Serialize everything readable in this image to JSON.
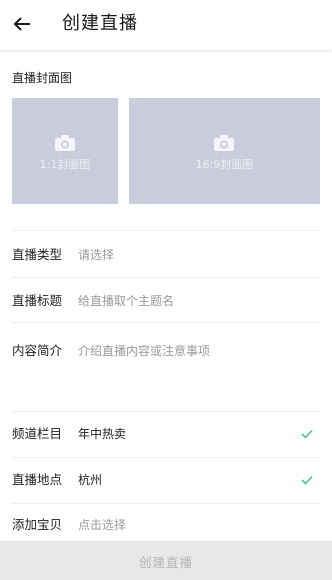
{
  "header": {
    "title": "创建直播"
  },
  "cover_section": {
    "title": "直播封面图",
    "square_caption": "1:1封面图",
    "wide_caption": "16:9封面图"
  },
  "form": {
    "type": {
      "label": "直播类型",
      "placeholder": "请选择"
    },
    "live_title": {
      "label": "直播标题",
      "placeholder": "给直播取个主题名"
    },
    "intro": {
      "label": "内容简介",
      "placeholder": "介绍直播内容或注意事项"
    },
    "channel": {
      "label": "频道栏目",
      "value": "年中热卖"
    },
    "location": {
      "label": "直播地点",
      "value": "杭州"
    },
    "goods": {
      "label": "添加宝贝",
      "placeholder": "点击选择"
    }
  },
  "footer": {
    "submit_label": "创建直播"
  },
  "colors": {
    "cover_placeholder": "#c9ccda",
    "check_green": "#4cc29a",
    "footer_bg": "#e8e8ea"
  },
  "icons": {
    "back": "arrow-left-icon",
    "camera": "camera-icon",
    "check": "check-icon"
  }
}
